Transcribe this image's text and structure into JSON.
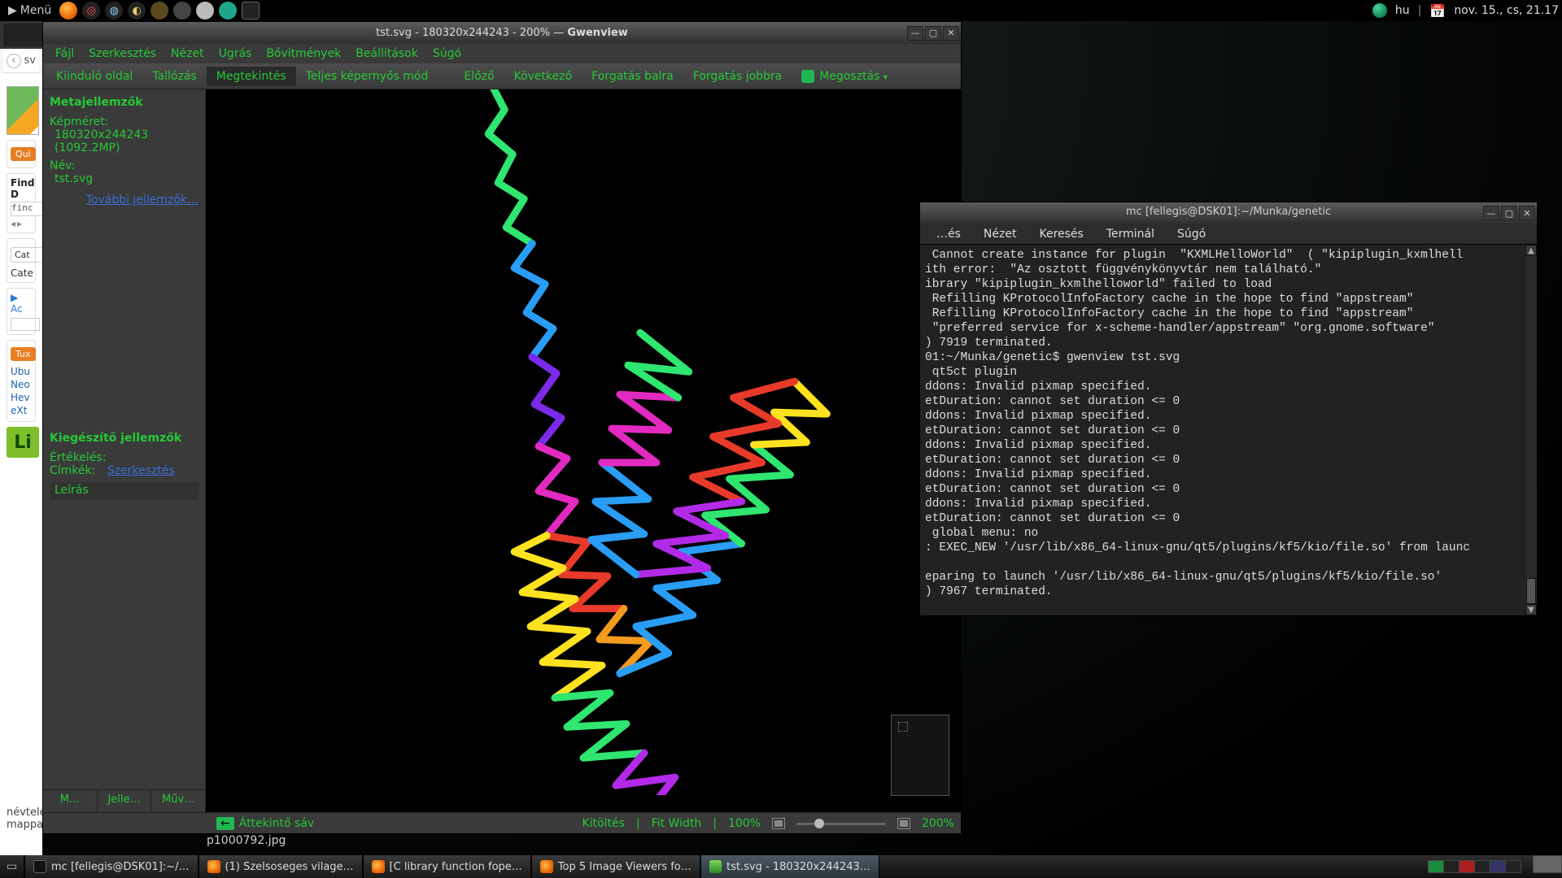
{
  "top_panel": {
    "menu_label": "Menü",
    "keyboard_layout": "hu",
    "clock": "nov. 15., cs, 21.17"
  },
  "browser_sliver": {
    "tab_label": "sv",
    "quick_btn": "Qui",
    "find_label": "Find D",
    "find_value": "finc",
    "cat_btn": "Cat",
    "cat_line": "Cate",
    "ac_label": "Ac",
    "tux_btn": "Tux",
    "list": [
      "Ubu",
      "Neo",
      "Hev",
      "eXt"
    ],
    "linux_badge": "Li",
    "overlay_top": "névtelen mappa",
    "overlay_bottom": "p1000792.jpg"
  },
  "gwenview": {
    "titlebar": {
      "file": "tst.svg",
      "detail": "180320x244243 - 200%",
      "app": "Gwenview"
    },
    "menubar": [
      "Fájl",
      "Szerkesztés",
      "Nézet",
      "Ugrás",
      "Bővítmények",
      "Beállítások",
      "Súgó"
    ],
    "toolbar": {
      "start_page": "Kiinduló oldal",
      "browse": "Tallózás",
      "view": "Megtekintés",
      "fullscreen": "Teljes képernyős mód",
      "prev": "Előző",
      "next": "Következő",
      "rotate_left": "Forgatás balra",
      "rotate_right": "Forgatás jobbra",
      "share": "Megosztás"
    },
    "sidepanel": {
      "meta_heading": "Metajellemzők",
      "size_label": "Képméret:",
      "size_value": "180320x244243",
      "mp_value": "(1092.2MP)",
      "name_label": "Név:",
      "name_value": "tst.svg",
      "more_props": "További jellemzők…",
      "extra_heading": "Kiegészítő jellemzők",
      "rating_label": "Értékelés:",
      "tags_label": "Címkék:",
      "edit_link": "Szerkesztés",
      "desc_placeholder": "Leírás"
    },
    "sidetabs": [
      "M…",
      "Jelle…",
      "Műv…"
    ],
    "statusbar": {
      "overview": "Áttekintő sáv",
      "fill": "Kitöltés",
      "fit_width": "Fit Width",
      "p100": "100%",
      "zoom_value": "200%"
    }
  },
  "terminal": {
    "title": "mc [fellegis@DSK01]:~/Munka/genetic",
    "menubar": [
      "…és",
      "Nézet",
      "Keresés",
      "Terminál",
      "Súgó"
    ],
    "lines": [
      " Cannot create instance for plugin  \"KXMLHelloWorld\"  ( \"kipiplugin_kxmlhell",
      "ith error:  \"Az osztott függvénykönyvtár nem található.\"",
      "ibrary \"kipiplugin_kxmlhelloworld\" failed to load",
      " Refilling KProtocolInfoFactory cache in the hope to find \"appstream\"",
      " Refilling KProtocolInfoFactory cache in the hope to find \"appstream\"",
      " \"preferred service for x-scheme-handler/appstream\" \"org.gnome.software\"",
      ") 7919 terminated.",
      "01:~/Munka/genetic$ gwenview tst.svg",
      " qt5ct plugin",
      "ddons: Invalid pixmap specified.",
      "etDuration: cannot set duration <= 0",
      "ddons: Invalid pixmap specified.",
      "etDuration: cannot set duration <= 0",
      "ddons: Invalid pixmap specified.",
      "etDuration: cannot set duration <= 0",
      "ddons: Invalid pixmap specified.",
      "etDuration: cannot set duration <= 0",
      "ddons: Invalid pixmap specified.",
      "etDuration: cannot set duration <= 0",
      " global menu: no",
      ": EXEC_NEW '/usr/lib/x86_64-linux-gnu/qt5/plugins/kf5/kio/file.so' from launc",
      "",
      "eparing to launch '/usr/lib/x86_64-linux-gnu/qt5/plugins/kf5/kio/file.so'",
      ") 7967 terminated.",
      ""
    ]
  },
  "taskbar": {
    "tasks": [
      {
        "icon": "term",
        "label": "mc [fellegis@DSK01]:~/…"
      },
      {
        "icon": "ff",
        "label": "(1) Szelsoseges vilage…"
      },
      {
        "icon": "ff",
        "label": "[C library function fope…"
      },
      {
        "icon": "ff",
        "label": "Top 5 Image Viewers fo…"
      },
      {
        "icon": "gv",
        "label": "tst.svg - 180320x244243…"
      }
    ]
  },
  "under_label": "p1000792.jpg"
}
